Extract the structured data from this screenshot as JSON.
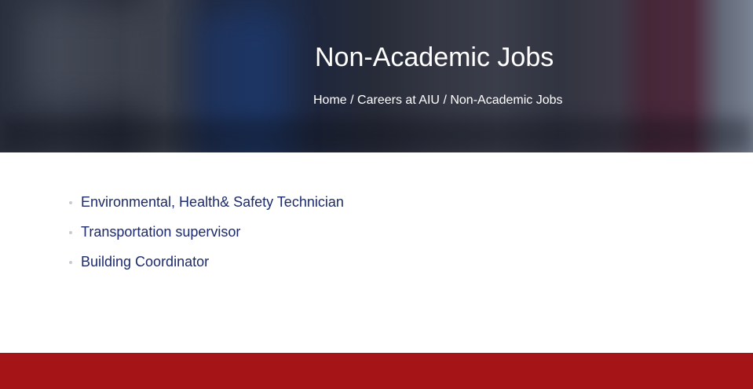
{
  "hero": {
    "title": "Non-Academic Jobs",
    "breadcrumb": {
      "home": "Home",
      "separator": "/",
      "careers": "Careers at AIU",
      "current": "Non-Academic Jobs"
    }
  },
  "jobs": [
    "Environmental, Health& Safety Technician",
    "Transportation supervisor",
    "Building Coordinator"
  ],
  "colors": {
    "job_text": "#1c2a6b",
    "footer_bar": "#a51416",
    "hero_text": "#ffffff"
  }
}
